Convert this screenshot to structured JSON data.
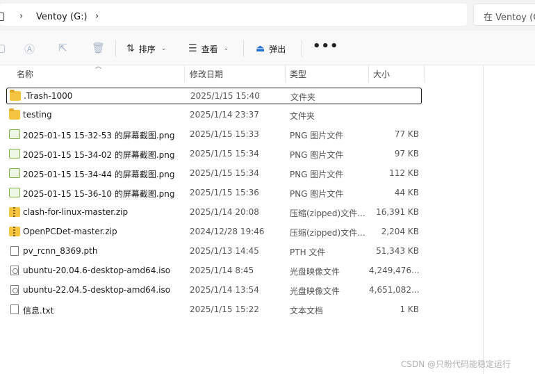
{
  "address": {
    "breadcrumb": "Ventoy (G:)",
    "search_placeholder": "在 Ventoy (G"
  },
  "toolbar": {
    "sort_label": "排序",
    "view_label": "查看",
    "eject_label": "弹出",
    "more_label": "•••"
  },
  "columns": {
    "name": "名称",
    "date": "修改日期",
    "type": "类型",
    "size": "大小"
  },
  "files": [
    {
      "name": ".Trash-1000",
      "date": "2025/1/15 15:40",
      "type": "文件夹",
      "size": "",
      "icon": "folder-icon",
      "selected": true
    },
    {
      "name": "testing",
      "date": "2025/1/14 23:37",
      "type": "文件夹",
      "size": "",
      "icon": "folder-icon"
    },
    {
      "name": "2025-01-15 15-32-53 的屏幕截图.png",
      "date": "2025/1/15 15:33",
      "type": "PNG 图片文件",
      "size": "77 KB",
      "icon": "png-file-icon"
    },
    {
      "name": "2025-01-15 15-34-02 的屏幕截图.png",
      "date": "2025/1/15 15:34",
      "type": "PNG 图片文件",
      "size": "97 KB",
      "icon": "png-file-icon"
    },
    {
      "name": "2025-01-15 15-34-44 的屏幕截图.png",
      "date": "2025/1/15 15:34",
      "type": "PNG 图片文件",
      "size": "112 KB",
      "icon": "png-file-icon"
    },
    {
      "name": "2025-01-15 15-36-10 的屏幕截图.png",
      "date": "2025/1/15 15:36",
      "type": "PNG 图片文件",
      "size": "44 KB",
      "icon": "png-file-icon"
    },
    {
      "name": "clash-for-linux-master.zip",
      "date": "2025/1/14 20:08",
      "type": "压缩(zipped)文件...",
      "size": "16,391 KB",
      "icon": "zip-file-icon"
    },
    {
      "name": "OpenPCDet-master.zip",
      "date": "2024/12/28 19:46",
      "type": "压缩(zipped)文件...",
      "size": "2,204 KB",
      "icon": "zip-file-icon"
    },
    {
      "name": "pv_rcnn_8369.pth",
      "date": "2025/1/13 14:45",
      "type": "PTH 文件",
      "size": "51,343 KB",
      "icon": "file-icon"
    },
    {
      "name": "ubuntu-20.04.6-desktop-amd64.iso",
      "date": "2025/1/14 8:45",
      "type": "光盘映像文件",
      "size": "4,249,476...",
      "icon": "disc-image-icon"
    },
    {
      "name": "ubuntu-22.04.5-desktop-amd64.iso",
      "date": "2025/1/14 13:54",
      "type": "光盘映像文件",
      "size": "4,651,082...",
      "icon": "disc-image-icon"
    },
    {
      "name": "信息.txt",
      "date": "2025/1/15 15:22",
      "type": "文本文档",
      "size": "1 KB",
      "icon": "text-file-icon"
    }
  ],
  "watermark": "CSDN @只盼代码能稳定运行"
}
